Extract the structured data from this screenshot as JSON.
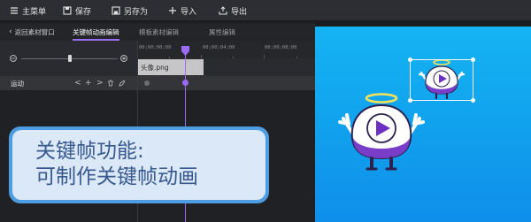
{
  "toolbar": {
    "main_menu": "主菜单",
    "save": "保存",
    "save_as": "另存为",
    "import": "导入",
    "export": "导出"
  },
  "tabs": {
    "back": "返回素材窗口",
    "keyframe": "关键帧动画编辑",
    "template": "模板素材编辑",
    "property": "属性编辑"
  },
  "timeline": {
    "ticks": [
      "00;00;00;00",
      "00;00;04;00",
      "00;00;08;00"
    ],
    "clip_name": "头像.png",
    "track_label": "运动",
    "track_controls": [
      "<",
      "+",
      ">"
    ]
  },
  "caption": {
    "line1": "关键帧功能:",
    "line2": "可制作关键帧动画"
  },
  "colors": {
    "accent": "#9b6cf6",
    "preview_top": "#14b4f2",
    "caption_border": "#4c9de2",
    "caption_text": "#37598e"
  }
}
